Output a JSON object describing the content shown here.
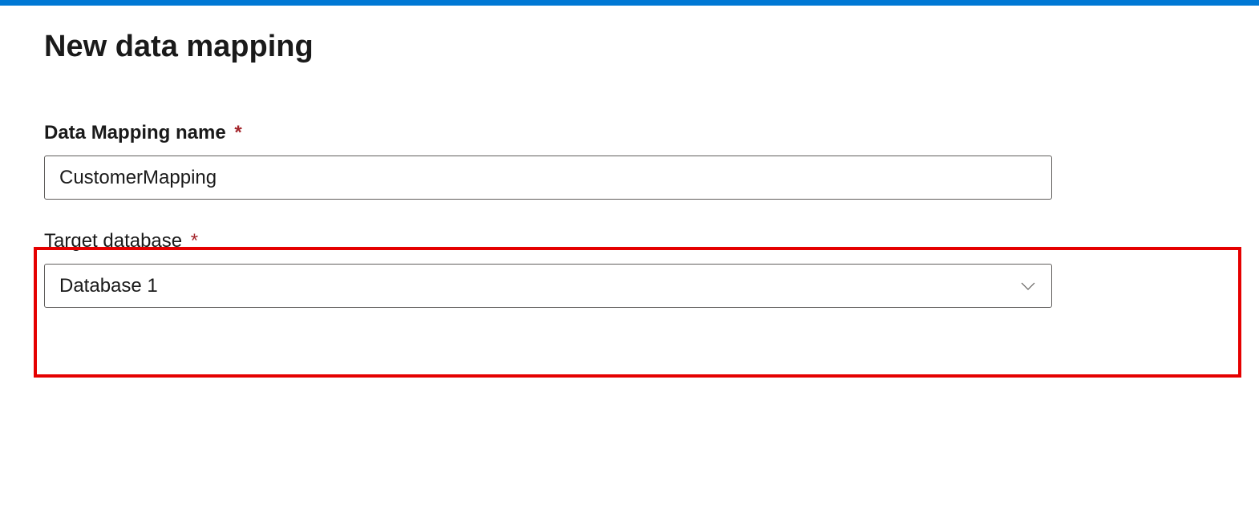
{
  "header": {
    "title": "New data mapping"
  },
  "fields": {
    "name": {
      "label": "Data Mapping name",
      "required_marker": "*",
      "value": "CustomerMapping"
    },
    "targetDatabase": {
      "label": "Target database",
      "required_marker": "*",
      "selected": "Database 1"
    }
  }
}
